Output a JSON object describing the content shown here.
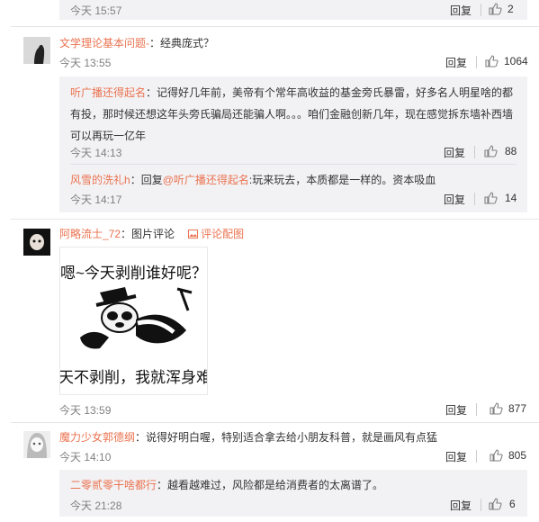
{
  "reply_label": "回复",
  "pic_comment_label": "评论配图",
  "top": {
    "time": "今天 15:57",
    "likes": "2"
  },
  "comments": [
    {
      "user": "文学理论基本问题-",
      "text": "：经典庞式？",
      "time": "今天 13:55",
      "likes": "1064",
      "replies": [
        {
          "user": "听广播还得起名",
          "text": "：记得好几年前，美帝有个常年高收益的基金旁氏暴雷，好多名人明星啥的都有投，那时候还想这年头旁氏骗局还能骗人啊。。。咱们金融创新几年，现在感觉拆东墙补西墙可以再玩一亿年",
          "time": "今天 14:13",
          "likes": "88"
        },
        {
          "user": "风雪的洗礼h",
          "text_prefix": "：回复",
          "mention": "@听广播还得起名",
          "text": ":玩来玩去，本质都是一样的。资本吸血",
          "time": "今天 14:17",
          "likes": "14"
        }
      ]
    },
    {
      "user": "阿略流士_72",
      "text": "：图片评论",
      "time": "今天 13:59",
      "likes": "877",
      "image": {
        "line1": "嗯~今天剥削谁好呢？",
        "line2": "天不剥削，我就浑身难"
      }
    },
    {
      "user": "魔力少女郭德纲",
      "text": "：说得好明白喔，特别适合拿去给小朋友科普，就是画风有点猛",
      "time": "今天 14:10",
      "likes": "805",
      "replies": [
        {
          "user": "二零贰零干啥都行",
          "text": "：越看越难过，风险都是给消费者的太离谱了。",
          "time": "今天 21:28",
          "likes": "6"
        }
      ]
    }
  ]
}
